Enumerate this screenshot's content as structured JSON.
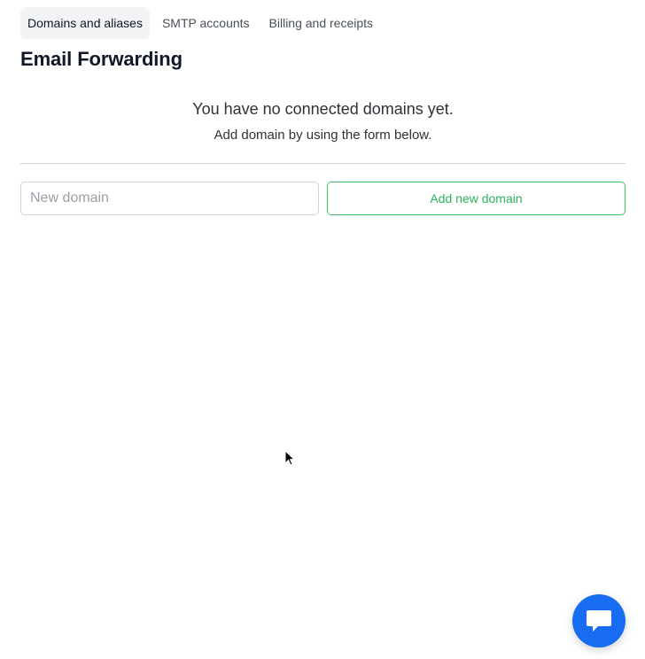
{
  "tabs": [
    {
      "label": "Domains and aliases",
      "active": true
    },
    {
      "label": "SMTP accounts",
      "active": false
    },
    {
      "label": "Billing and receipts",
      "active": false
    }
  ],
  "page": {
    "title": "Email Forwarding"
  },
  "empty_state": {
    "title": "You have no connected domains yet.",
    "subtitle": "Add domain by using the form below."
  },
  "form": {
    "domain_placeholder": "New domain",
    "domain_value": "",
    "submit_label": "Add new domain"
  },
  "chat": {
    "icon": "chat-bubble-icon"
  },
  "colors": {
    "accent_green": "#2bb55a",
    "chat_blue": "#176cf2",
    "active_tab_background": "#f1f3f5"
  }
}
